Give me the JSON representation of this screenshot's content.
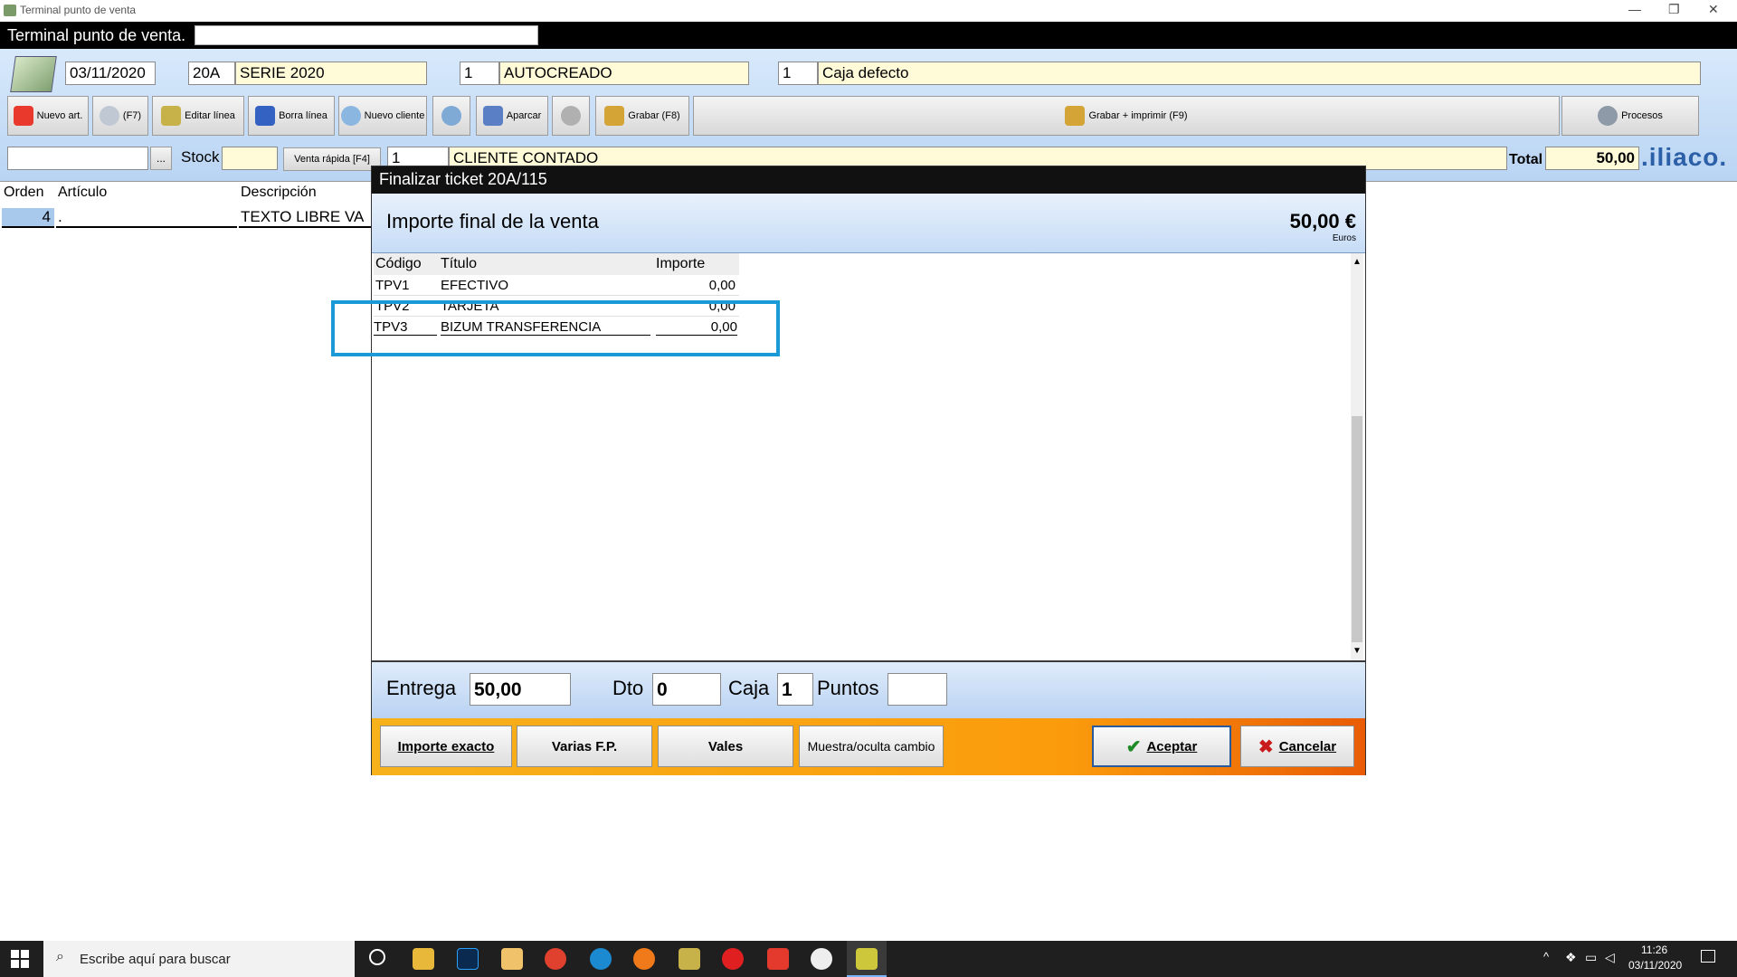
{
  "window": {
    "app_title": "Terminal punto de venta",
    "restore_glyph": "❐",
    "close_glyph": "✕"
  },
  "header": {
    "title": "Terminal punto de venta."
  },
  "doc": {
    "date": "03/11/2020",
    "serie_code": "20A",
    "serie_name": "SERIE 2020",
    "user_code": "1",
    "user_name": "AUTOCREADO",
    "caja_code": "1",
    "caja_name": "Caja defecto"
  },
  "toolbar": {
    "nuevo_art": "Nuevo art.",
    "f7": "(F7)",
    "editar_linea": "Editar línea",
    "borra_linea": "Borra línea",
    "nuevo_cliente": "Nuevo cliente",
    "aparcar": "Aparcar",
    "grabar": "Grabar (F8)",
    "grabar_imprimir": "Grabar + imprimir (F9)",
    "procesos": "Procesos"
  },
  "row3": {
    "dots": "...",
    "stock_label": "Stock",
    "venta_rapida": "Venta rápida [F4]",
    "client_code": "1",
    "client_name": "CLIENTE CONTADO",
    "total_label": "Total",
    "total_value": "50,00",
    "brand": ".iliaco."
  },
  "lines_table": {
    "headers": [
      "Orden",
      "Artículo",
      "Descripción"
    ],
    "row": {
      "orden": "4",
      "articulo": ".",
      "descripcion": "TEXTO LIBRE VA"
    }
  },
  "dialog": {
    "title": "Finalizar ticket 20A/115",
    "heading": "Importe final de la venta",
    "amount": "50,00 €",
    "currency": "Euros",
    "grid_headers": [
      "Código",
      "Título",
      "Importe"
    ],
    "grid_rows": [
      {
        "codigo": "TPV1",
        "titulo": "EFECTIVO",
        "importe": "0,00"
      },
      {
        "codigo": "TPV2",
        "titulo": "TARJETA",
        "importe": "0,00"
      },
      {
        "codigo": "TPV3",
        "titulo": "BIZUM TRANSFERENCIA",
        "importe": "0,00"
      }
    ],
    "entrega_label": "Entrega",
    "entrega_value": "50,00",
    "dto_label": "Dto",
    "dto_value": "0",
    "caja_label": "Caja",
    "caja_value": "1",
    "puntos_label": "Puntos",
    "puntos_value": "",
    "buttons": {
      "importe_exacto": "Importe exacto",
      "varias_fp": "Varias F.P.",
      "vales": "Vales",
      "muestra_cambio": "Muestra/oculta cambio",
      "aceptar": "Aceptar",
      "cancelar": "Cancelar"
    }
  },
  "colors": {
    "highlight_box": "#1a9ad6",
    "selected_row": "#a8c8ec",
    "accent_orange": "#f7a214"
  },
  "taskbar": {
    "search_placeholder": "Escribe aquí para buscar",
    "time": "11:26",
    "date": "03/11/2020",
    "app_icons": [
      "cortana-icon",
      "explorer-icon",
      "photoshop-icon",
      "folder-icon",
      "chrome-icon",
      "edge-icon",
      "firefox-icon",
      "app-icon",
      "rx-icon",
      "anydesk-icon",
      "app2-icon",
      "tpv-icon"
    ]
  }
}
